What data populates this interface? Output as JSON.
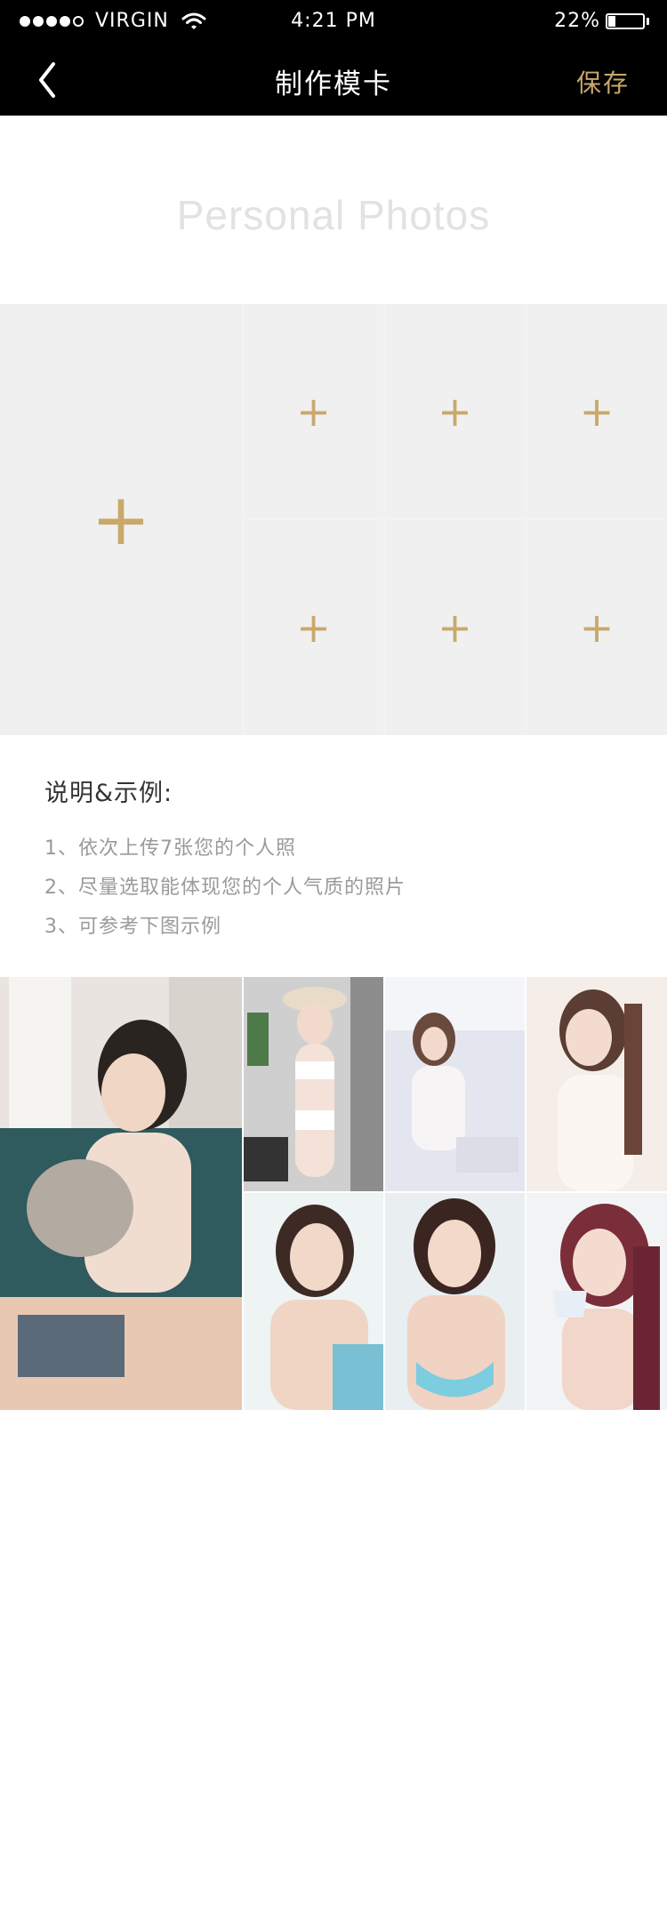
{
  "status_bar": {
    "carrier": "VIRGIN",
    "time": "4:21 PM",
    "battery": "22%",
    "battery_level": 0.22,
    "signal_dots_filled": 4,
    "signal_dots_total": 5
  },
  "nav": {
    "title": "制作模卡",
    "save_label": "保存",
    "back_icon": "chevron-left-icon"
  },
  "section_title": "Personal Photos",
  "upload_slots": {
    "count": 7,
    "icon": "plus-icon",
    "plus_glyph": "+"
  },
  "notes": {
    "title": "说明&示例:",
    "items": [
      "1、依次上传7张您的个人照",
      "2、尽量选取能体现您的个人气质的照片",
      "3、可参考下图示例"
    ]
  },
  "example_photos": {
    "count": 7
  },
  "colors": {
    "accent": "#c9a86a",
    "bar_background": "#000000",
    "slot_background": "#f0f0f0"
  }
}
